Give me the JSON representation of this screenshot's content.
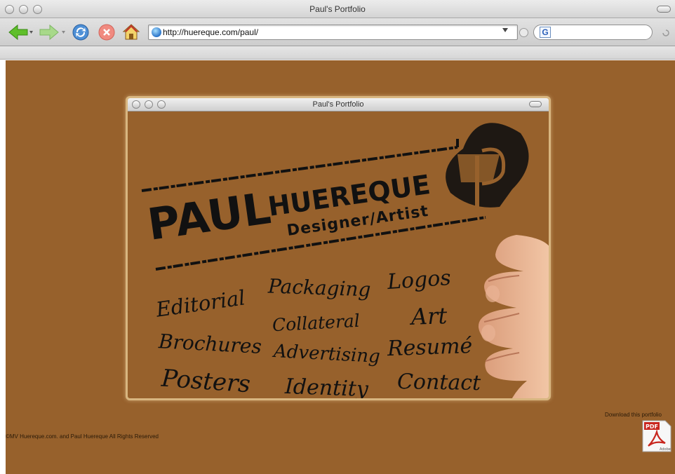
{
  "browser": {
    "window_title": "Paul's Portfolio",
    "url": "http://huereque.com/paul/",
    "search_value": ""
  },
  "mock_window": {
    "title": "Paul's Portfolio"
  },
  "logo": {
    "first_name": "PAUL",
    "last_name": "HUEREQUE",
    "tagline": "Designer/Artist"
  },
  "menu": {
    "editorial": "Editorial",
    "packaging": "Packaging",
    "logos": "Logos",
    "collateral": "Collateral",
    "art": "Art",
    "brochures": "Brochures",
    "advertising": "Advertising",
    "resume": "Resumé",
    "posters": "Posters",
    "identity": "Identity",
    "contact": "Contact"
  },
  "footer": {
    "copyright": "©MV Huereque.com. and Paul Huereque All Rights Reserved",
    "download_label": "Download this portfolio",
    "pdf_badge": "PDF",
    "pdf_maker": "Adobe"
  },
  "colors": {
    "page_bg": "#97612c",
    "frame": "#d8b680",
    "ink": "#111111"
  },
  "icons": {
    "back": "back-arrow-icon",
    "forward": "forward-arrow-icon",
    "reload": "reload-icon",
    "stop": "stop-icon",
    "home": "home-icon",
    "site": "globe-icon",
    "search_engine": "google-icon",
    "pdf": "pdf-icon"
  }
}
